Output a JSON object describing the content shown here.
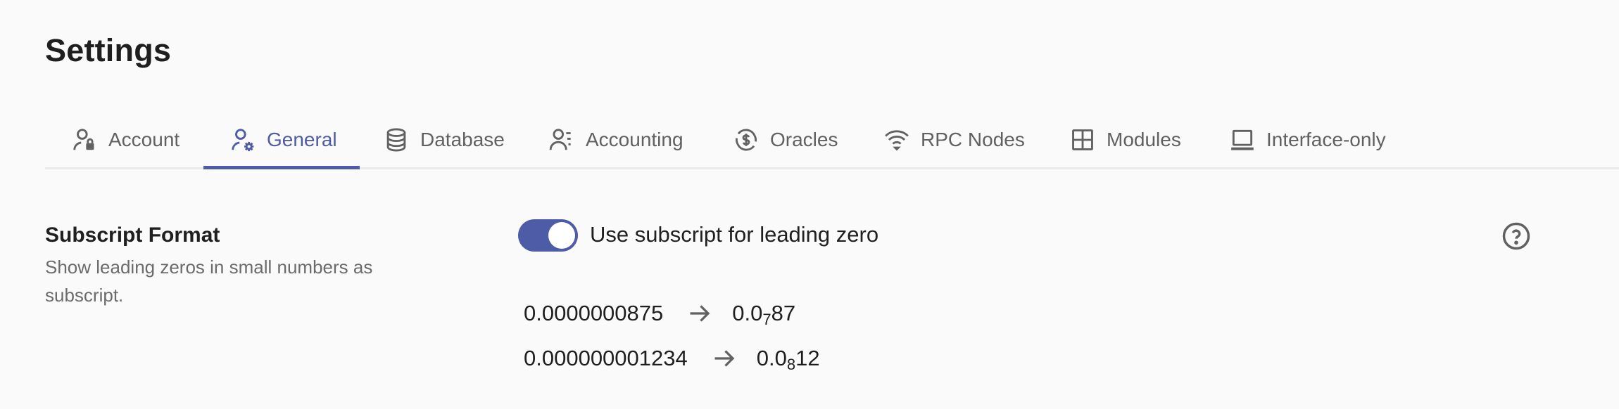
{
  "header": {
    "title": "Settings"
  },
  "tabs": [
    {
      "label": "Account",
      "icon": "user-lock-icon",
      "active": false
    },
    {
      "label": "General",
      "icon": "user-settings-icon",
      "active": true
    },
    {
      "label": "Database",
      "icon": "database-icon",
      "active": false
    },
    {
      "label": "Accounting",
      "icon": "user-list-icon",
      "active": false
    },
    {
      "label": "Oracles",
      "icon": "exchange-dollar-icon",
      "active": false
    },
    {
      "label": "RPC Nodes",
      "icon": "wifi-icon",
      "active": false
    },
    {
      "label": "Modules",
      "icon": "grid-icon",
      "active": false
    },
    {
      "label": "Interface-only",
      "icon": "laptop-icon",
      "active": false
    }
  ],
  "colors": {
    "accent": "#4e5ba6",
    "tab_text": "#616161",
    "divider": "#ebebeb"
  },
  "section": {
    "title": "Subscript Format",
    "description": "Show leading zeros in small numbers as subscript.",
    "toggle": {
      "label": "Use subscript for leading zero",
      "checked": true
    },
    "help_icon": "help-circle-icon",
    "examples": [
      {
        "input": "0.0000000875",
        "prefix": "0.0",
        "subscript": "7",
        "suffix": "87"
      },
      {
        "input": "0.000000001234",
        "prefix": "0.0",
        "subscript": "8",
        "suffix": "12"
      }
    ]
  }
}
